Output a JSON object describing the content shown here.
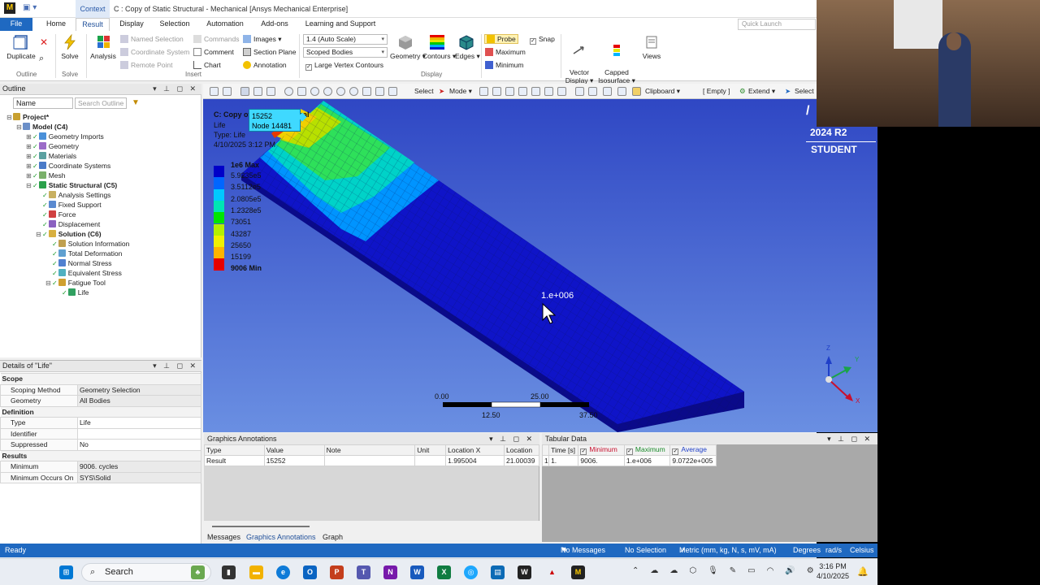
{
  "title_bar": {
    "context_tab": "Context",
    "window_title": "C : Copy of Static Structural - Mechanical [Ansys Mechanical Enterprise]"
  },
  "ribbon_tabs": [
    "File",
    "Home",
    "Result",
    "Display",
    "Selection",
    "Automation",
    "Add-ons",
    "Learning and Support"
  ],
  "quick_launch_placeholder": "Quick Launch",
  "ribbon": {
    "outline_group": {
      "duplicate": "Duplicate",
      "label": "Outline"
    },
    "solve_group": {
      "solve": "Solve",
      "label": "Solve"
    },
    "insert_group": {
      "analysis": "Analysis",
      "named_selection": "Named Selection",
      "coordinate_system": "Coordinate System",
      "remote_point": "Remote Point",
      "commands": "Commands",
      "comment": "Comment",
      "chart": "Chart",
      "images": "Images",
      "section_plane": "Section Plane",
      "annotation": "Annotation",
      "label": "Insert"
    },
    "display_group": {
      "scale_select": "1.4 (Auto Scale)",
      "scope_select": "Scoped Bodies",
      "large_vertex": "Large Vertex Contours",
      "geometry": "Geometry",
      "contours": "Contours",
      "edges": "Edges",
      "label": "Display"
    },
    "probe_group": {
      "probe": "Probe",
      "maximum": "Maximum",
      "minimum": "Minimum",
      "snap": "Snap"
    },
    "vector_display": "Vector\nDisplay",
    "capped_isosurface": "Capped\nIsosurface",
    "views": "Views"
  },
  "outline": {
    "header": "Outline",
    "filter_select": "Name",
    "search_placeholder": "Search Outline",
    "tree": [
      {
        "label": "Project*",
        "level": 0,
        "bold": true,
        "icon": "project-icon"
      },
      {
        "label": "Model (C4)",
        "level": 1,
        "bold": true,
        "icon": "model-icon"
      },
      {
        "label": "Geometry Imports",
        "level": 2,
        "icon": "geometry-imports-icon"
      },
      {
        "label": "Geometry",
        "level": 2,
        "icon": "geometry-icon"
      },
      {
        "label": "Materials",
        "level": 2,
        "icon": "materials-icon"
      },
      {
        "label": "Coordinate Systems",
        "level": 2,
        "icon": "coordinate-systems-icon"
      },
      {
        "label": "Mesh",
        "level": 2,
        "icon": "mesh-icon"
      },
      {
        "label": "Static Structural (C5)",
        "level": 2,
        "bold": true,
        "icon": "static-structural-icon"
      },
      {
        "label": "Analysis Settings",
        "level": 3,
        "icon": "analysis-settings-icon"
      },
      {
        "label": "Fixed Support",
        "level": 3,
        "icon": "fixed-support-icon"
      },
      {
        "label": "Force",
        "level": 3,
        "icon": "force-icon"
      },
      {
        "label": "Displacement",
        "level": 3,
        "icon": "displacement-icon"
      },
      {
        "label": "Solution (C6)",
        "level": 3,
        "bold": true,
        "icon": "solution-icon"
      },
      {
        "label": "Solution Information",
        "level": 4,
        "icon": "solution-information-icon"
      },
      {
        "label": "Total Deformation",
        "level": 4,
        "icon": "total-deformation-icon"
      },
      {
        "label": "Normal Stress",
        "level": 4,
        "icon": "normal-stress-icon"
      },
      {
        "label": "Equivalent Stress",
        "level": 4,
        "icon": "equivalent-stress-icon"
      },
      {
        "label": "Fatigue Tool",
        "level": 4,
        "icon": "fatigue-tool-icon"
      },
      {
        "label": "Life",
        "level": 5,
        "icon": "life-icon"
      }
    ]
  },
  "details": {
    "header": "Details of \"Life\"",
    "rows": [
      {
        "section": "Scope"
      },
      {
        "key": "Scoping Method",
        "value": "Geometry Selection"
      },
      {
        "key": "Geometry",
        "value": "All Bodies"
      },
      {
        "section": "Definition"
      },
      {
        "key": "Type",
        "value": "Life"
      },
      {
        "key": "Identifier",
        "value": ""
      },
      {
        "key": "Suppressed",
        "value": "No"
      },
      {
        "section": "Results"
      },
      {
        "key": "Minimum",
        "value": "9006. cycles"
      },
      {
        "key": "Minimum Occurs On",
        "value": "SYS\\Solid"
      }
    ]
  },
  "viewport_toolbar": {
    "select": "Select",
    "mode": "Mode",
    "clipboard": "Clipboard",
    "empty": "[ Empty ]",
    "extend": "Extend",
    "select2": "Select"
  },
  "viewport": {
    "result_title": "C: Copy of Static Structural",
    "result_type_line1": "Life",
    "result_type_line2": "Type: Life",
    "result_date": "4/10/2025 3:12 PM",
    "legend_top": "1e6 Max",
    "legend_values": [
      "5.9235e5",
      "3.5112e5",
      "2.0805e5",
      "1.2328e5",
      "73051",
      "43287",
      "25650",
      "15199",
      "9006 Min"
    ],
    "legend_colors": [
      "#0000c8",
      "#0066ff",
      "#00c8ff",
      "#00e6b4",
      "#00e600",
      "#b4f000",
      "#f0f000",
      "#ffb400",
      "#e60000"
    ],
    "probe_label_value": "15252",
    "probe_label_node": "Node 14481",
    "point_label": "1.e+006",
    "scale_ticks_top": [
      "0.00",
      "25.00"
    ],
    "scale_ticks_bottom": [
      "12.50",
      "37.50"
    ],
    "version": "2024 R2",
    "student": "STUDENT",
    "axis_labels": {
      "z": "Z",
      "y": "Y",
      "x": "X"
    }
  },
  "graphics_annotations": {
    "header": "Graphics Annotations",
    "columns": [
      "Type",
      "Value",
      "Note",
      "Unit",
      "Location X",
      "Location"
    ],
    "rows": [
      [
        "Result",
        "15252",
        "",
        "",
        "1.995004",
        "21.00039"
      ]
    ]
  },
  "tabular_data": {
    "header": "Tabular Data",
    "columns": [
      "Time [s]",
      "Minimum",
      "Maximum",
      "Average"
    ],
    "rows": [
      [
        "1",
        "1.",
        "9006.",
        "1.e+006",
        "9.0722e+005"
      ]
    ]
  },
  "bottom_tabs": [
    "Messages",
    "Graphics Annotations",
    "Graph"
  ],
  "status_bar": {
    "ready": "Ready",
    "messages": "No Messages",
    "selection": "No Selection",
    "units": "Metric (mm, kg, N, s, mV, mA)",
    "angle": "Degrees",
    "rate": "rad/s",
    "temp": "Celsius"
  },
  "taskbar": {
    "search": "Search",
    "time": "3:16 PM",
    "date": "4/10/2025"
  }
}
